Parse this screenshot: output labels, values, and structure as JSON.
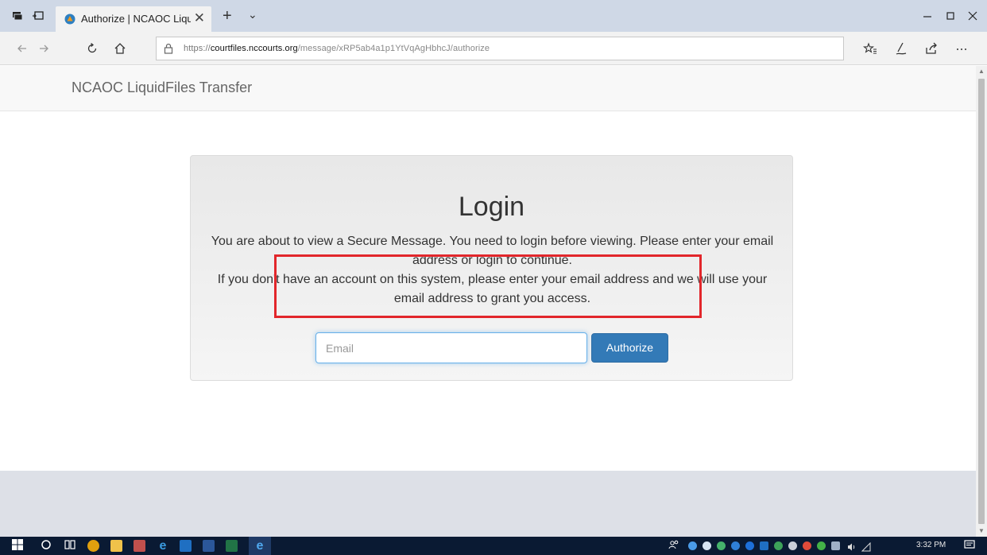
{
  "browser": {
    "tab_title": "Authorize | NCAOC Liqu",
    "tab_close": "✕",
    "new_tab": "+",
    "tab_menu": "⌄",
    "url_protocol": "https://",
    "url_domain": "courtfiles.nccourts.org",
    "url_path": "/message/xRP5ab4a1p1YtVqAgHbhcJ/authorize",
    "icons": [
      "tab-actions-icon",
      "set-tabs-aside-icon",
      "back-arrow-icon",
      "forward-arrow-icon",
      "refresh-icon",
      "home-icon",
      "lock-icon",
      "favorites-icon",
      "pen-icon",
      "share-icon",
      "more-icon",
      "minimize-icon",
      "maximize-icon",
      "close-window-icon"
    ]
  },
  "page": {
    "brand": "NCAOC LiquidFiles Transfer",
    "login_title": "Login",
    "message_line1": "You are about to view a Secure Message. You need to login before viewing. Please enter your email address or login to continue.",
    "message_line2": "If you don't have an account on this system, please enter your email address and we will use your email address to grant you access.",
    "email_placeholder": "Email",
    "email_value": "",
    "authorize_label": "Authorize",
    "colors": {
      "button": "#337ab7",
      "highlight": "#e2262b",
      "tabbar": "#cfd8e6",
      "taskbar": "#0a1a33"
    }
  },
  "taskbar": {
    "time": "3:32 PM",
    "apps": [
      "chrome",
      "file-explorer",
      "store",
      "edge",
      "outlook",
      "word",
      "excel",
      "ie"
    ]
  }
}
